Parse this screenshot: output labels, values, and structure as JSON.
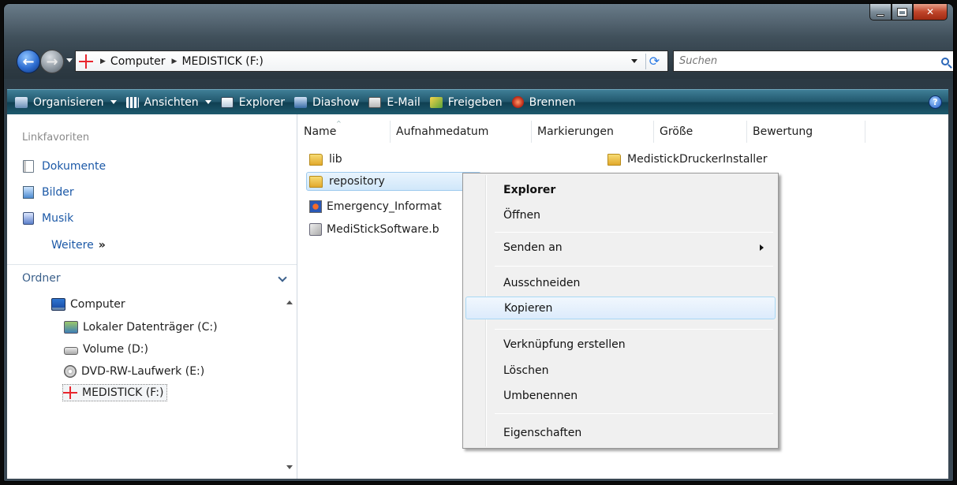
{
  "address": {
    "segments": [
      "Computer",
      "MEDISTICK (F:)"
    ]
  },
  "search": {
    "placeholder": "Suchen"
  },
  "toolbar": {
    "organize": "Organisieren",
    "views": "Ansichten",
    "explorer": "Explorer",
    "slideshow": "Diashow",
    "email": "E-Mail",
    "share": "Freigeben",
    "burn": "Brennen",
    "help": "?"
  },
  "sidebar": {
    "favorites_title": "Linkfavoriten",
    "favorites": [
      "Dokumente",
      "Bilder",
      "Musik"
    ],
    "more": "Weitere",
    "more_chevron": "»",
    "folders_title": "Ordner",
    "tree": [
      "Computer",
      "Lokaler Datenträger (C:)",
      "Volume (D:)",
      "DVD-RW-Laufwerk (E:)",
      "MEDISTICK (F:)"
    ]
  },
  "columns": [
    "Name",
    "Aufnahmedatum",
    "Markierungen",
    "Größe",
    "Bewertung"
  ],
  "files": [
    "lib",
    "repository",
    "Emergency_Informat",
    "MediStickSoftware.b",
    "MedistickDruckerInstaller"
  ],
  "context_menu": {
    "items": [
      "Explorer",
      "Öffnen",
      "Senden an",
      "Ausschneiden",
      "Kopieren",
      "Verknüpfung erstellen",
      "Löschen",
      "Umbenennen",
      "Eigenschaften"
    ],
    "bold_item": "Explorer",
    "highlighted_item": "Kopieren"
  },
  "colors": {
    "toolbar": "#22586d",
    "link": "#1c59a7",
    "highlight_border": "#a8d8f4"
  }
}
